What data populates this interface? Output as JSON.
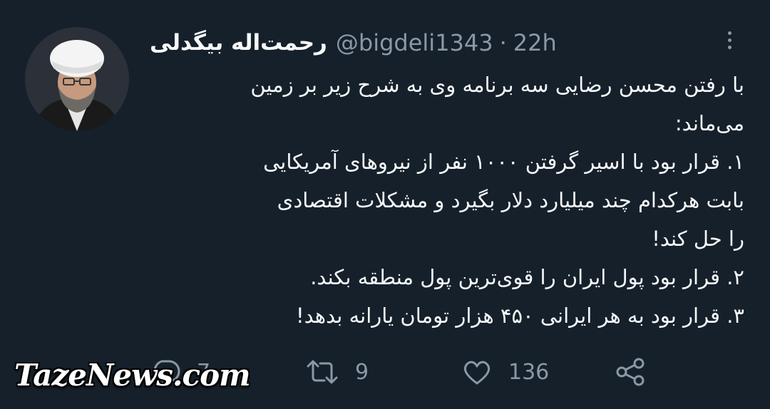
{
  "author": {
    "display_name": "رحمت‌اله بیگدلی",
    "handle": "@bigdeli1343",
    "separator": "·",
    "time": "22h"
  },
  "tweet": {
    "lines": [
      "با رفتن محسن رضایی سه برنامه وی به شرح زیر بر زمین",
      "می‌ماند:",
      "۱. قرار بود با اسیر گرفتن ۱۰۰۰ نفر از نیروهای آمریکایی",
      "بابت هرکدام چند میلیارد دلار بگیرد و مشکلات اقتصادی",
      "را حل کند!",
      "۲. قرار بود پول ایران را قوی‌ترین پول منطقه بکند.",
      "۳. قرار بود به هر ایرانی ۴۵۰ هزار تومان یارانه بدهد!"
    ]
  },
  "actions": {
    "reply_icon": "reply-icon",
    "reply_count": "7",
    "retweet_icon": "retweet-icon",
    "retweet_count": "9",
    "like_icon": "heart-icon",
    "like_count": "136",
    "share_icon": "share-icon"
  },
  "watermark": "TazeNews.com",
  "colors": {
    "background": "#15202b",
    "text": "#f7f9f9",
    "muted": "#8b98a5"
  }
}
